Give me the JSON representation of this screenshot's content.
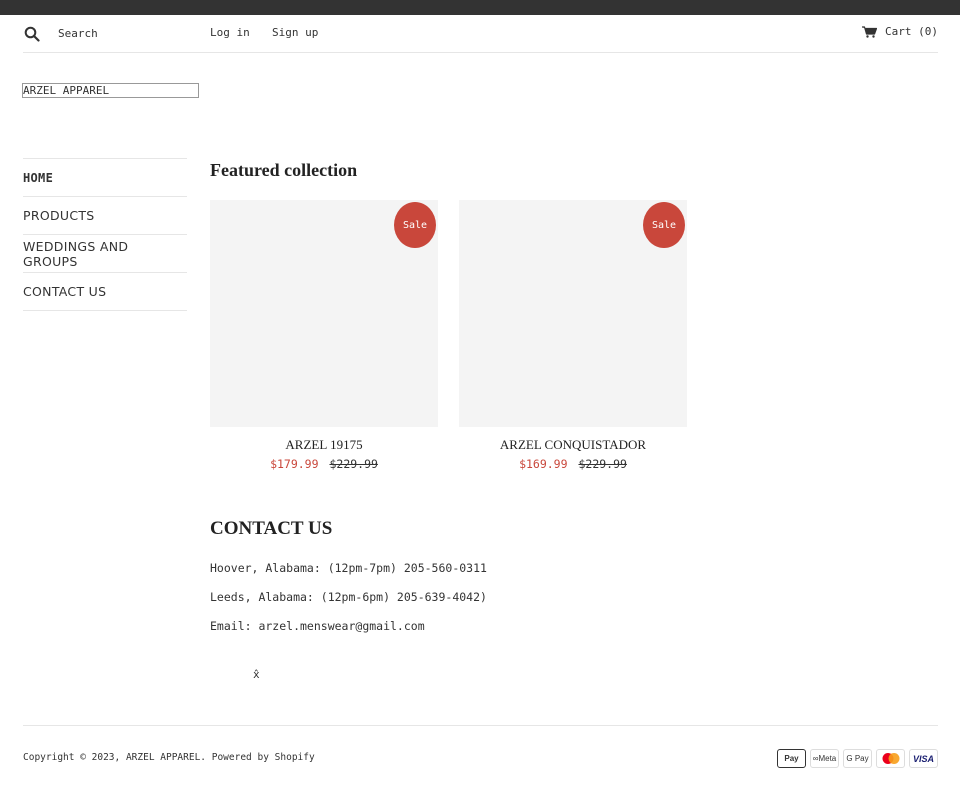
{
  "header": {
    "search_placeholder": "Search",
    "login": "Log in",
    "signup": "Sign up",
    "cart": "Cart (0)"
  },
  "logo": {
    "text": "ARZEL APPAREL"
  },
  "sidebar": {
    "items": [
      {
        "label": "HOME",
        "active": true
      },
      {
        "label": "PRODUCTS"
      },
      {
        "label": "WEDDINGS AND GROUPS"
      },
      {
        "label": "CONTACT US"
      }
    ]
  },
  "featured": {
    "title": "Featured collection",
    "products": [
      {
        "name": "ARZEL 19175",
        "badge": "Sale",
        "sale_price": "$179.99",
        "original_price": "$229.99"
      },
      {
        "name": "ARZEL CONQUISTADOR",
        "badge": "Sale",
        "sale_price": "$169.99",
        "original_price": "$229.99"
      }
    ]
  },
  "contact": {
    "title": "CONTACT US",
    "lines": [
      "Hoover, Alabama: (12pm-7pm) 205-560-0311",
      "Leeds, Alabama: (12pm-6pm) 205-639-4042)",
      "Email: arzel.menswear@gmail.com"
    ],
    "glyph": "x̂"
  },
  "footer": {
    "copyright": "Copyright © 2023, ARZEL APPAREL. Powered by Shopify",
    "payments": [
      "Apple Pay",
      "Meta",
      "G Pay",
      "Mastercard",
      "VISA"
    ]
  },
  "colors": {
    "sale": "#c9473b",
    "topbar": "#333333",
    "image_placeholder": "#f4f4f4"
  }
}
